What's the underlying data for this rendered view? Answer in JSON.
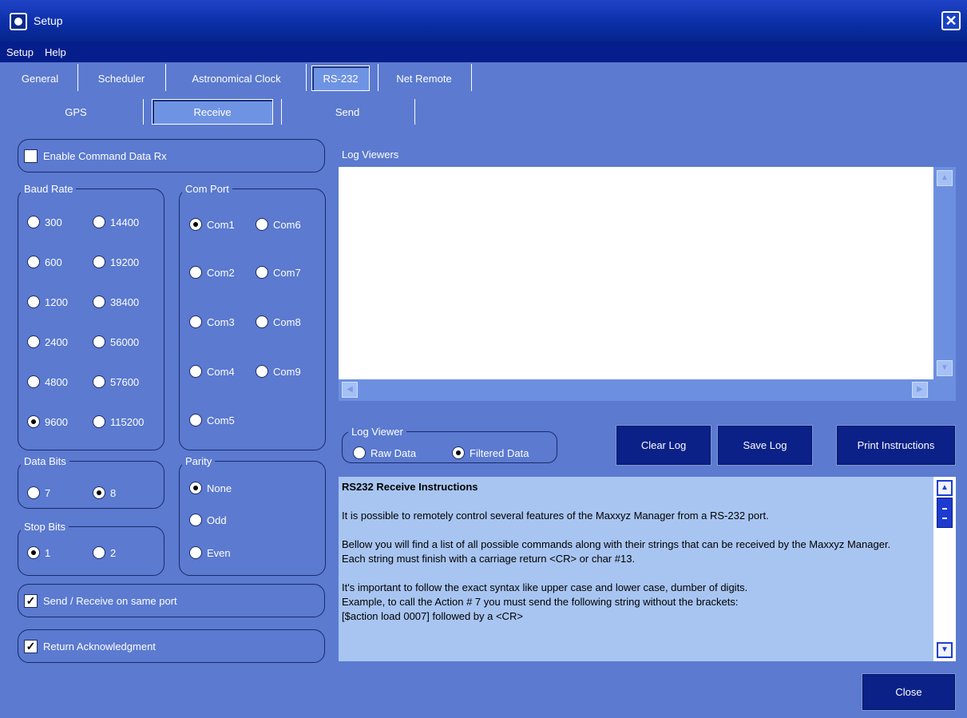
{
  "window": {
    "title": "Setup",
    "close_glyph": "✕"
  },
  "menu": {
    "setup": "Setup",
    "help": "Help"
  },
  "tabs": [
    "General",
    "Scheduler",
    "Astronomical Clock",
    "RS-232",
    "Net Remote"
  ],
  "subtabs": [
    "GPS",
    "Receive",
    "Send"
  ],
  "enable_rx": {
    "label": "Enable Command Data Rx",
    "checked": false
  },
  "baud": {
    "title": "Baud Rate",
    "options": [
      "300",
      "14400",
      "600",
      "19200",
      "1200",
      "38400",
      "2400",
      "56000",
      "4800",
      "57600",
      "9600",
      "115200"
    ],
    "selected": "9600"
  },
  "comport": {
    "title": "Com Port",
    "options": [
      "Com1",
      "Com6",
      "Com2",
      "Com7",
      "Com3",
      "Com8",
      "Com4",
      "Com9",
      "Com5"
    ],
    "selected": "Com1"
  },
  "databits": {
    "title": "Data Bits",
    "options": [
      "7",
      "8"
    ],
    "selected": "8"
  },
  "parity": {
    "title": "Parity",
    "options": [
      "None",
      "Odd",
      "Even"
    ],
    "selected": "None"
  },
  "stopbits": {
    "title": "Stop Bits",
    "options": [
      "1",
      "2"
    ],
    "selected": "1"
  },
  "same_port": {
    "label": "Send / Receive on same port",
    "checked": true
  },
  "ack": {
    "label": "Return Acknowledgment",
    "checked": true
  },
  "log": {
    "title": "Log Viewers",
    "viewer_title": "Log Viewer",
    "raw": "Raw Data",
    "filtered": "Filtered Data",
    "selected": "Filtered Data"
  },
  "buttons": {
    "clear": "Clear Log",
    "save": "Save Log",
    "print": "Print Instructions",
    "close": "Close"
  },
  "instructions": {
    "heading": "RS232 Receive Instructions",
    "p1": "It is possible to remotely control several features of the Maxxyz Manager from a RS-232 port.",
    "p2a": "Bellow you will find a list of all possible commands along with their strings that can be received by the Maxxyz Manager.",
    "p2b": "Each string must finish with a carriage return <CR> or char #13.",
    "p3a": "It's important to follow the exact syntax like upper case and lower case, dumber of digits.",
    "p3b": "Example, to call the Action # 7 you must send the following string without the brackets:",
    "p3c": "[$action load 0007] followed by a <CR>"
  }
}
